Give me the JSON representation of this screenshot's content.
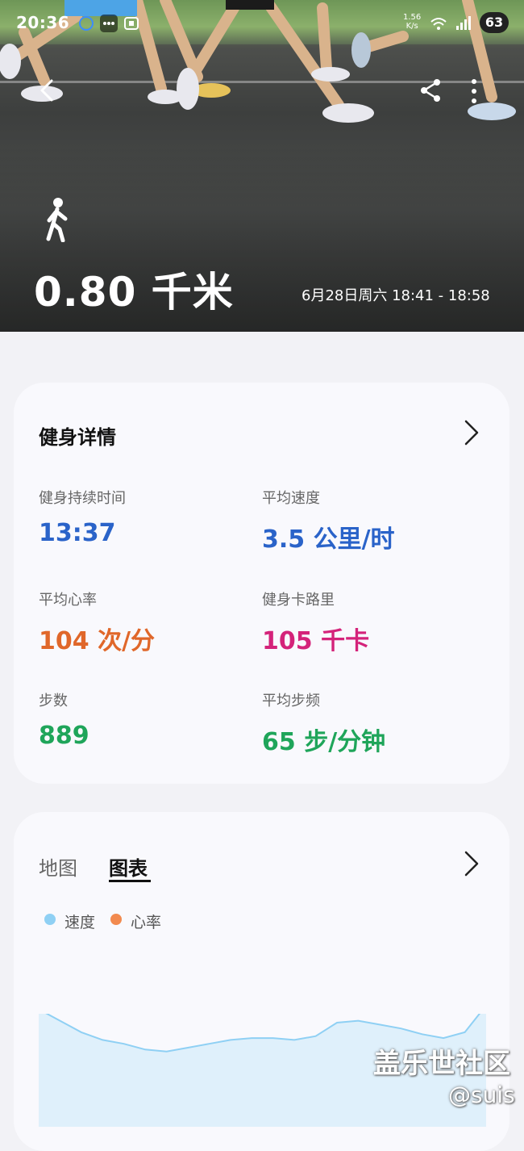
{
  "status_bar": {
    "time": "20:36",
    "net_speed_value": "1.56",
    "net_speed_unit": "K/s",
    "battery": "63"
  },
  "hero": {
    "distance": "0.80 千米",
    "datetime": "6月28日周六 18:41 - 18:58",
    "activity_icon": "walking-person-icon"
  },
  "details": {
    "title": "健身详情",
    "metrics": [
      {
        "label": "健身持续时间",
        "value": "13:37",
        "color": "#2a63c9"
      },
      {
        "label": "平均速度",
        "value": "3.5 公里/时",
        "color": "#2a63c9"
      },
      {
        "label": "平均心率",
        "value": "104 次/分",
        "color": "#e0672a"
      },
      {
        "label": "健身卡路里",
        "value": "105 千卡",
        "color": "#d4237a"
      },
      {
        "label": "步数",
        "value": "889",
        "color": "#1fa55a"
      },
      {
        "label": "平均步频",
        "value": "65 步/分钟",
        "color": "#1fa55a"
      }
    ]
  },
  "chart_card": {
    "tabs": [
      "地图",
      "图表"
    ],
    "active_tab": "图表",
    "legend": [
      {
        "label": "速度",
        "color": "#8fd0f4"
      },
      {
        "label": "心率",
        "color": "#f28a4f"
      }
    ]
  },
  "chart_data": {
    "type": "area",
    "title": "",
    "xlabel": "",
    "ylabel": "",
    "series": [
      {
        "name": "速度",
        "color": "#8fd0f4",
        "values": [
          3.9,
          3.6,
          3.3,
          3.1,
          3.0,
          2.85,
          2.8,
          2.9,
          3.0,
          3.1,
          3.15,
          3.15,
          3.1,
          3.2,
          3.55,
          3.6,
          3.5,
          3.4,
          3.25,
          3.15,
          3.3,
          4.0
        ]
      }
    ],
    "ylim": [
      0,
      10
    ]
  },
  "watermark": {
    "line1": "盖乐世社区",
    "line2": "@suis"
  }
}
